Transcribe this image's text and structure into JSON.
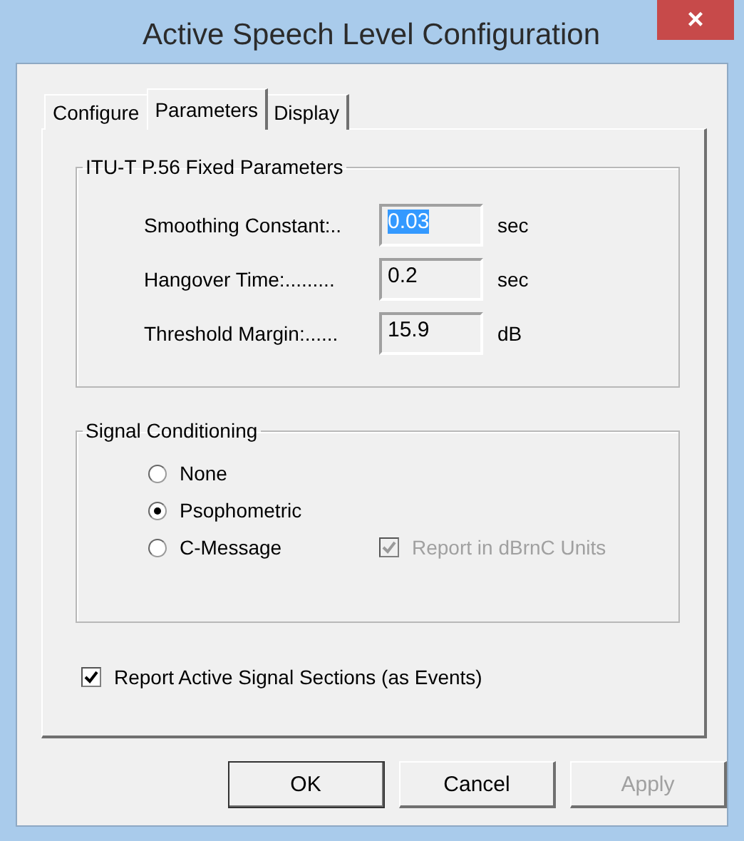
{
  "window": {
    "title": "Active Speech Level Configuration",
    "close": "×"
  },
  "tabs": [
    {
      "label": "Configure",
      "selected": false
    },
    {
      "label": "Parameters",
      "selected": true
    },
    {
      "label": "Display",
      "selected": false
    }
  ],
  "fixed_parameters": {
    "title": "ITU-T P.56 Fixed Parameters",
    "rows": [
      {
        "label": "Smoothing Constant:..",
        "value": "0.03",
        "unit": "sec",
        "text_selected": true
      },
      {
        "label": "Hangover Time:.........",
        "value": "0.2",
        "unit": "sec",
        "text_selected": false
      },
      {
        "label": "Threshold Margin:......",
        "value": "15.9",
        "unit": "dB",
        "text_selected": false
      }
    ]
  },
  "signal_conditioning": {
    "title": "Signal Conditioning",
    "options": [
      {
        "label": "None",
        "selected": false
      },
      {
        "label": "Psophometric",
        "selected": true
      },
      {
        "label": "C-Message",
        "selected": false
      }
    ],
    "units_checkbox": {
      "label": "Report in dBrnC Units",
      "checked": true,
      "disabled": true
    }
  },
  "report_checkbox": {
    "label": "Report Active Signal Sections (as Events)",
    "checked": true,
    "disabled": false
  },
  "buttons": [
    {
      "label": "OK",
      "disabled": false,
      "default": true
    },
    {
      "label": "Cancel",
      "disabled": false,
      "default": false
    },
    {
      "label": "Apply",
      "disabled": true,
      "default": false
    }
  ]
}
